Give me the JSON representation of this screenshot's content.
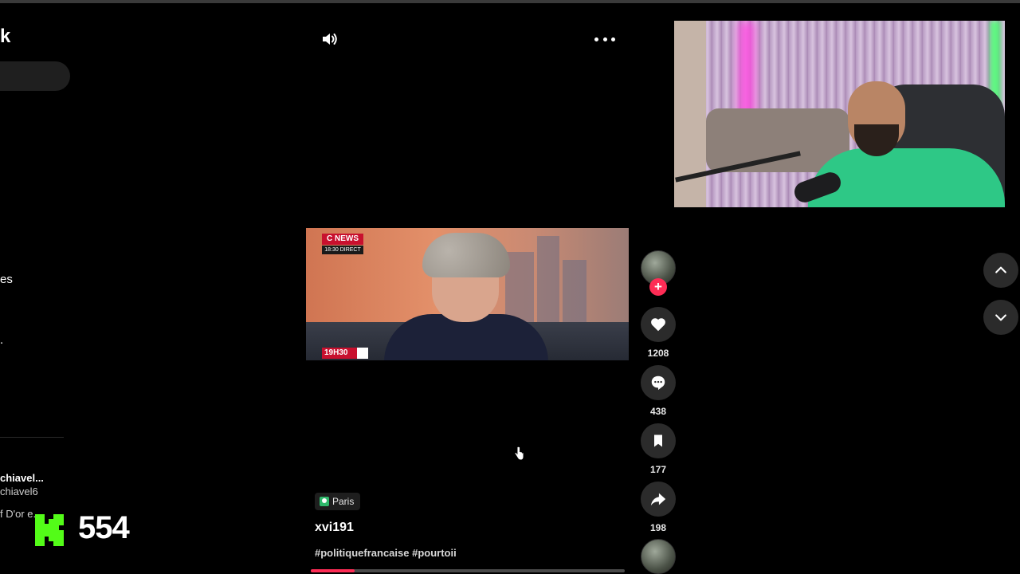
{
  "sidebar": {
    "logo_fragment": "k",
    "item_fragment_1": "es",
    "item_fragment_2": ".",
    "account": {
      "name": "chiavel...",
      "handle": "chiavel6",
      "extra": "f D'or e..."
    }
  },
  "overlay": {
    "viewer_count": "554",
    "brand_color": "#53fc18"
  },
  "video": {
    "channel_logo": "C NEWS",
    "channel_time": "18:30 DIRECT",
    "ticker_time": "19H30"
  },
  "post": {
    "location": "Paris",
    "username": "xvi191",
    "hashtags": "#politiquefrancaise #pourtoii",
    "progress_fraction": 0.14
  },
  "actions": {
    "likes": "1208",
    "comments": "438",
    "bookmarks": "177",
    "shares": "198"
  },
  "colors": {
    "accent": "#fe2c55",
    "button_bg": "#2b2b2b"
  }
}
